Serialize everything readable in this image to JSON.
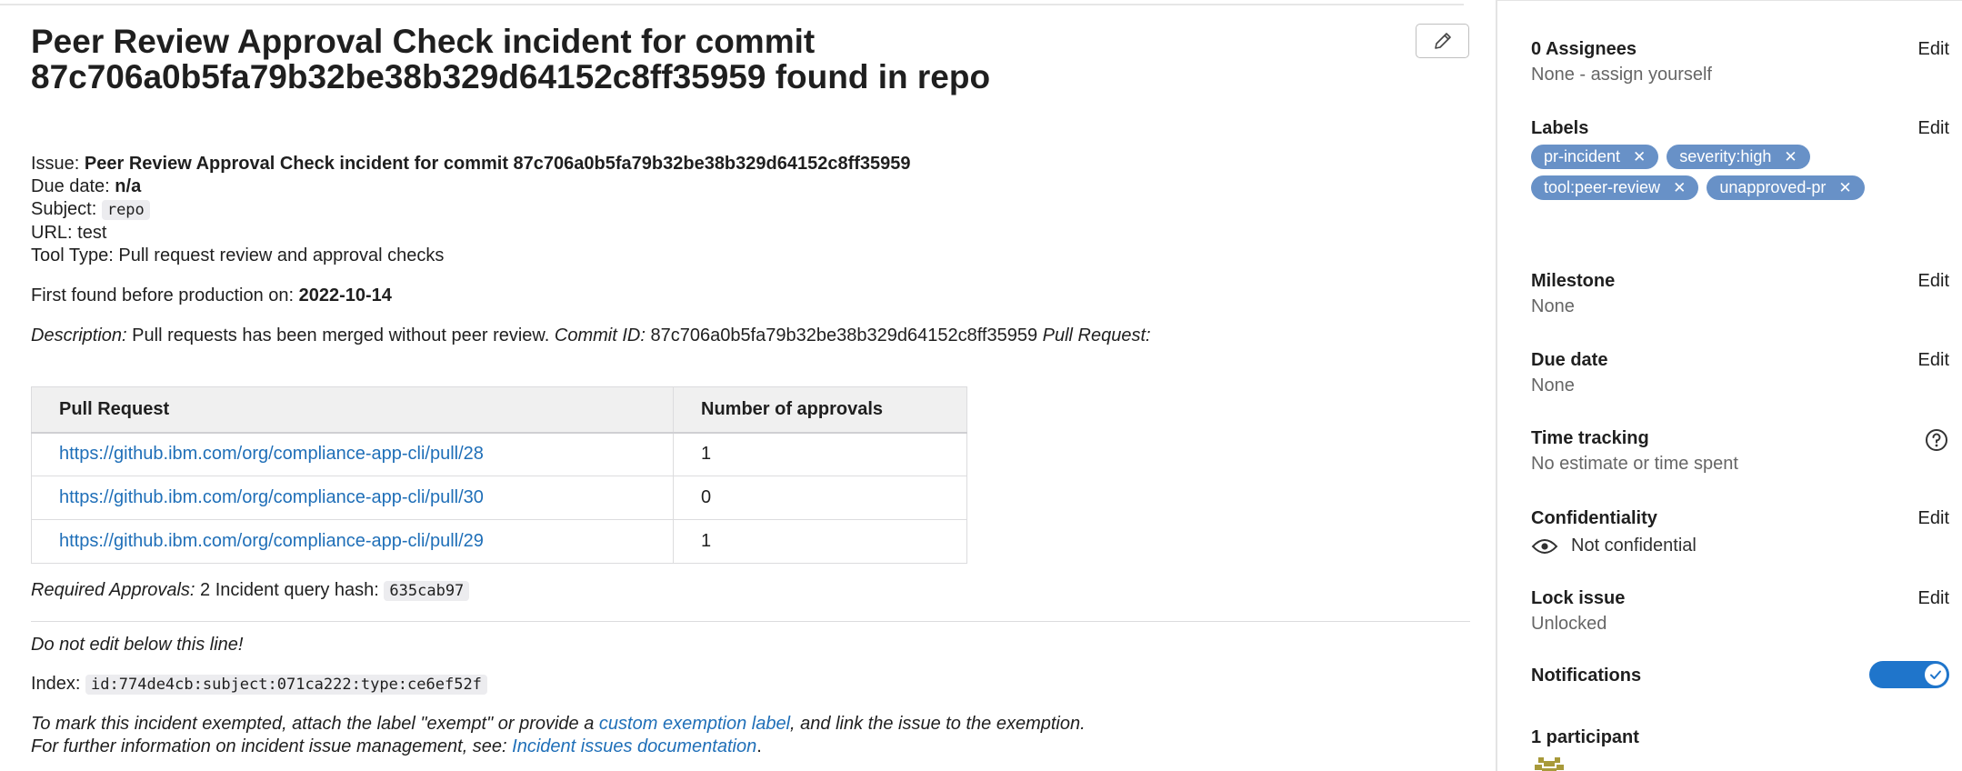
{
  "issue": {
    "title": "Peer Review Approval Check incident for commit 87c706a0b5fa79b32be38b329d64152c8ff35959 found in repo",
    "issue_label": "Issue:",
    "issue_value": "Peer Review Approval Check incident for commit 87c706a0b5fa79b32be38b329d64152c8ff35959",
    "due_label": "Due date:",
    "due_value": "n/a",
    "subject_label": "Subject:",
    "subject_value": "repo",
    "url_label": "URL:",
    "url_value": "test",
    "tool_label": "Tool Type:",
    "tool_value": "Pull request review and approval checks",
    "first_found_label": "First found before production on:",
    "first_found_value": "2022-10-14",
    "description_label": "Description:",
    "description_text": "Pull requests has been merged without peer review.",
    "commit_label": "Commit ID:",
    "commit_value": "87c706a0b5fa79b32be38b329d64152c8ff35959",
    "pr_label": "Pull Request:"
  },
  "pr_table": {
    "headers": [
      "Pull Request",
      "Number of approvals"
    ],
    "rows": [
      {
        "url": "https://github.ibm.com/org/compliance-app-cli/pull/28",
        "approvals": "1"
      },
      {
        "url": "https://github.ibm.com/org/compliance-app-cli/pull/30",
        "approvals": "0"
      },
      {
        "url": "https://github.ibm.com/org/compliance-app-cli/pull/29",
        "approvals": "1"
      }
    ]
  },
  "footer": {
    "required_label": "Required Approvals:",
    "required_value": "2",
    "hash_label": "Incident query hash:",
    "hash_value": "635cab97",
    "no_edit": "Do not edit below this line!",
    "index_label": "Index:",
    "index_value": "id:774de4cb:subject:071ca222:type:ce6ef52f",
    "exempt_text_1": "To mark this incident exempted, attach the label \"exempt\" or provide a",
    "exempt_link": "custom exemption label",
    "exempt_text_2": ", and link the issue to the exemption.",
    "info_text": "For further information on incident issue management, see:",
    "info_link": "Incident issues documentation",
    "info_end": "."
  },
  "sidebar": {
    "assignees_title": "0 Assignees",
    "assignees_value": "None - assign yourself",
    "labels_title": "Labels",
    "labels": [
      "pr-incident",
      "severity:high",
      "tool:peer-review",
      "unapproved-pr"
    ],
    "milestone_title": "Milestone",
    "milestone_value": "None",
    "due_title": "Due date",
    "due_value": "None",
    "time_title": "Time tracking",
    "time_value": "No estimate or time spent",
    "conf_title": "Confidentiality",
    "conf_value": "Not confidential",
    "lock_title": "Lock issue",
    "lock_value": "Unlocked",
    "notif_title": "Notifications",
    "notif_on": true,
    "participants_title": "1 participant",
    "edit_label": "Edit"
  },
  "colors": {
    "label_bg": "#6891c7",
    "toggle_on": "#1f75cb",
    "link": "#1f6fb8"
  }
}
